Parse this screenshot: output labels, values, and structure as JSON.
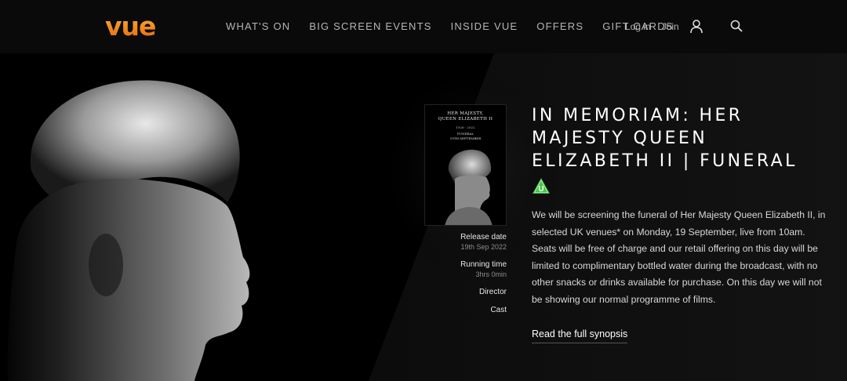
{
  "brand": {
    "logo_text": "vue",
    "accent": "#f39c33"
  },
  "nav": {
    "items": [
      {
        "label": "WHAT'S ON"
      },
      {
        "label": "BIG SCREEN EVENTS"
      },
      {
        "label": "INSIDE VUE"
      },
      {
        "label": "OFFERS"
      },
      {
        "label": "GIFT CARDS"
      }
    ]
  },
  "account": {
    "login": "Log in",
    "join": "Join",
    "user_icon": "user-icon",
    "search_icon": "search-icon"
  },
  "poster": {
    "title_line1": "HER MAJESTY,",
    "title_line2": "QUEEN ELIZABETH II",
    "years": "1926 - 2022",
    "funeral_line1": "FUNERAL",
    "funeral_line2": "19TH SEPTEMBER"
  },
  "meta": {
    "release_label": "Release date",
    "release_value": "19th Sep 2022",
    "running_label": "Running time",
    "running_value": "3hrs 0min",
    "director_label": "Director",
    "cast_label": "Cast"
  },
  "film": {
    "title": "IN MEMORIAM: HER MAJESTY QUEEN ELIZABETH II | FUNERAL",
    "rating": "U",
    "rating_color": "#3db83d",
    "synopsis": "We will be screening the funeral of Her Majesty Queen Elizabeth II, in selected UK venues* on Monday, 19 September, live from 10am. Seats will be free of charge and our retail offering on this day will be limited to complimentary bottled water during the broadcast, with no other snacks or drinks available for purchase. On this day we will not be showing our normal programme of films.",
    "read_more": "Read the full synopsis"
  }
}
